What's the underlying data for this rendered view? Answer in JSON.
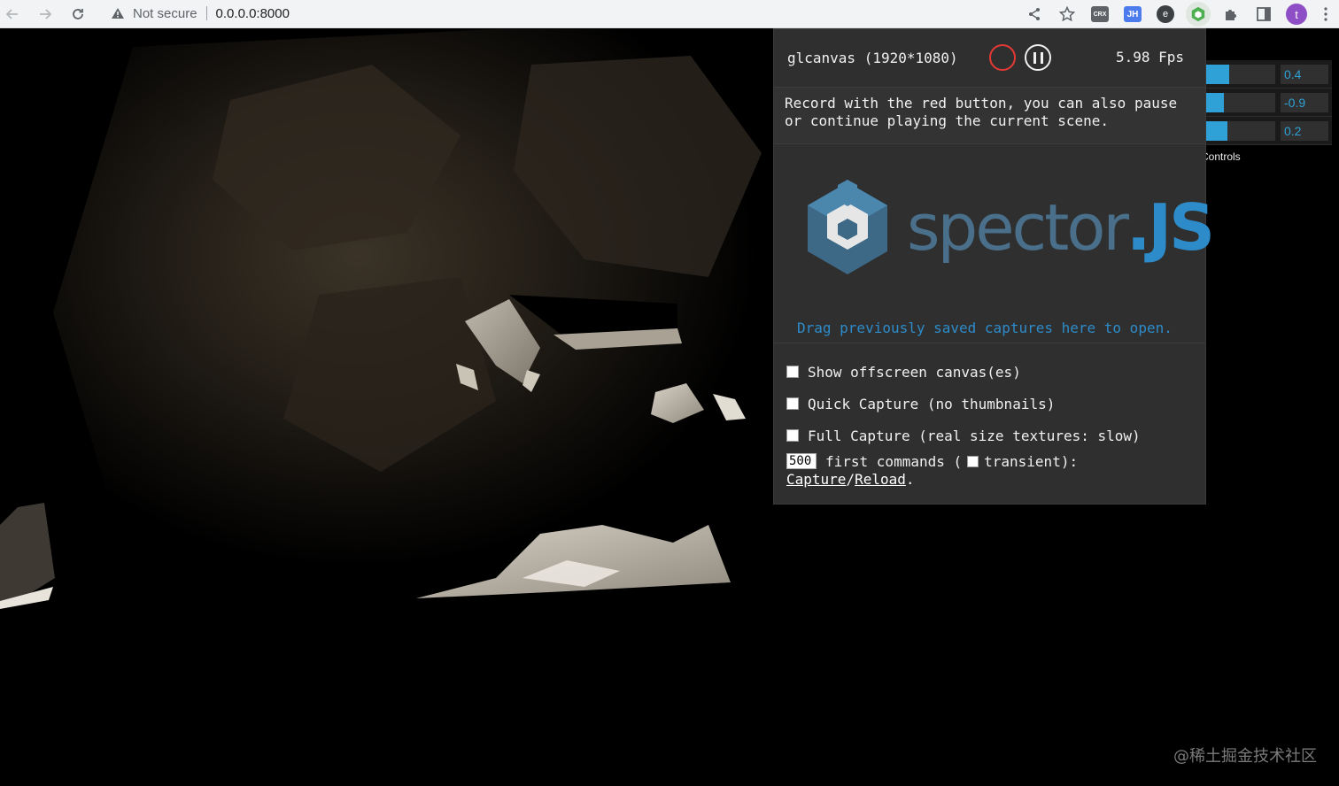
{
  "browser": {
    "security_label": "Not secure",
    "url": "0.0.0.0:8000",
    "extensions": [
      "CRX",
      "JH",
      "e"
    ],
    "profile_initial": "t",
    "icons": [
      "back-icon",
      "forward-icon",
      "reload-icon",
      "warning-icon",
      "share-icon",
      "star-icon",
      "puzzle-icon",
      "sidebar-icon",
      "kebab-menu-icon"
    ]
  },
  "gui": {
    "controls": [
      {
        "value_label": "0.4",
        "fill": 0.35
      },
      {
        "value_label": "-0.9",
        "fill": 0.27
      },
      {
        "value_label": "0.2",
        "fill": 0.32
      }
    ],
    "close_label": "Controls",
    "accent": "#2fa1d6"
  },
  "spector": {
    "canvas_label": "glcanvas (1920*1080)",
    "fps_label": "5.98 Fps",
    "help_text_1": "Record with the red button, you can also pause",
    "help_text_2": "or continue playing the current scene.",
    "logo_text_1": "spector",
    "logo_text_2": ".JS",
    "drop_text": "Drag previously saved captures here to open.",
    "options": [
      {
        "label": "Show offscreen canvas(es)",
        "checked": false
      },
      {
        "label": "Quick Capture (no thumbnails)",
        "checked": false
      },
      {
        "label": "Full Capture (real size textures: slow)",
        "checked": false
      }
    ],
    "command_count": "500",
    "commands_text": "first commands (",
    "transient_text": "transient):",
    "capture_link": "Capture",
    "slash": "/",
    "reload_link": "Reload",
    "period": ".",
    "record_color": "#e53935",
    "link_color": "#2e8bc9"
  },
  "watermark": "@稀土掘金技术社区"
}
